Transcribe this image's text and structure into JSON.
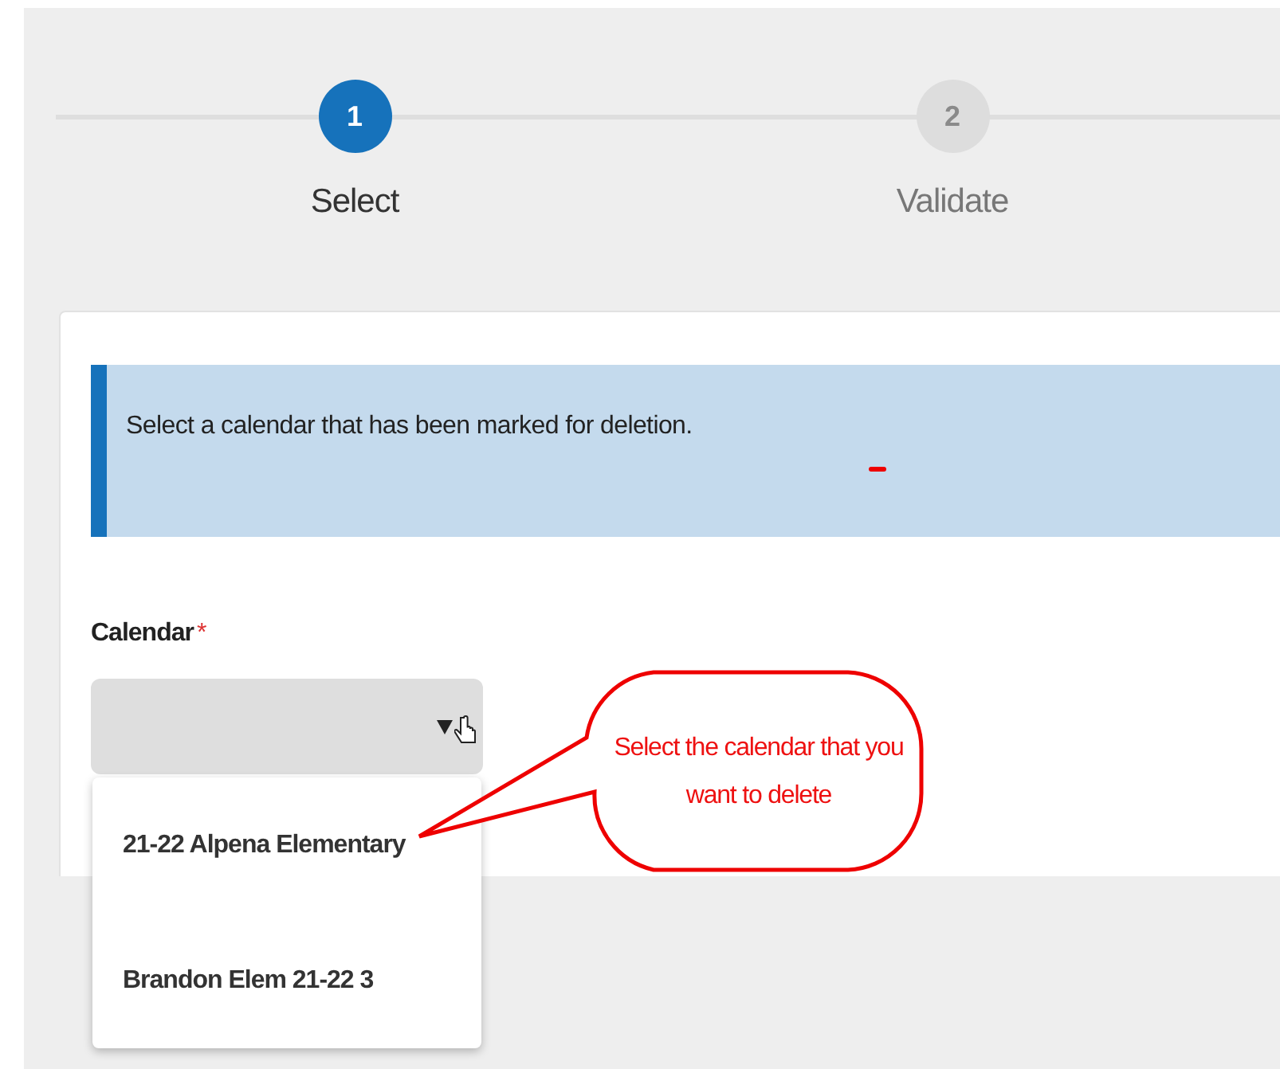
{
  "steps": [
    {
      "number": "1",
      "label": "Select",
      "selected": true
    },
    {
      "number": "2",
      "label": "Validate",
      "selected": false
    }
  ],
  "info": {
    "text": "Select a calendar that has been marked for deletion."
  },
  "calendar_field": {
    "label": "Calendar",
    "required_mark": "*",
    "expanded": true,
    "options": [
      {
        "label": "21-22 Alpena Elementary"
      },
      {
        "label": "Brandon Elem 21-22 3"
      }
    ]
  },
  "callout": {
    "text": "Select the calendar that you want to delete"
  }
}
